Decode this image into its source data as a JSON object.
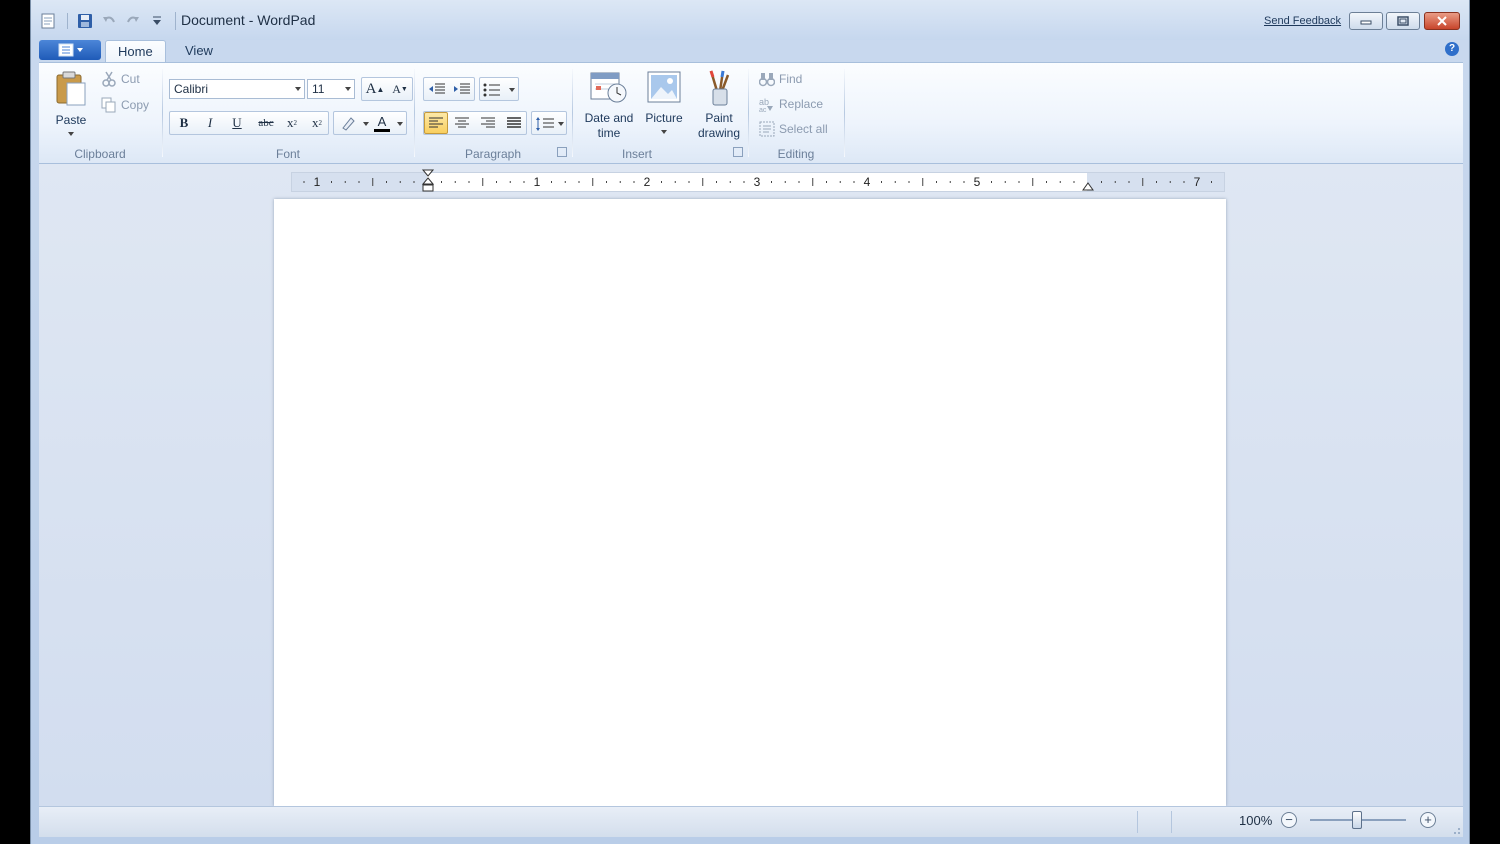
{
  "window": {
    "title": "Document - WordPad",
    "send_feedback": "Send Feedback"
  },
  "ribbon_tabs": {
    "home": "Home",
    "view": "View"
  },
  "help": "?",
  "clipboard": {
    "label": "Clipboard",
    "paste": "Paste",
    "cut": "Cut",
    "copy": "Copy"
  },
  "font": {
    "label": "Font",
    "family": "Calibri",
    "size": "11",
    "grow": "A",
    "shrink": "A",
    "bold": "B",
    "italic": "I",
    "underline": "U",
    "strikethrough": "abc",
    "subscript": "x",
    "superscript": "x",
    "color_letter": "A",
    "color_bar": "#000000"
  },
  "paragraph": {
    "label": "Paragraph"
  },
  "insert": {
    "label": "Insert",
    "datetime": [
      "Date and",
      "time"
    ],
    "picture": "Picture",
    "paint": [
      "Paint",
      "drawing"
    ]
  },
  "editing": {
    "label": "Editing",
    "find": "Find",
    "replace": "Replace",
    "select_all": "Select all"
  },
  "ruler": {
    "labels": [
      "1",
      "1",
      "2",
      "3",
      "4",
      "5",
      "7"
    ]
  },
  "status": {
    "zoom": "100%",
    "zoom_out": "−",
    "zoom_in": "+"
  },
  "colors": {
    "accent": "#1f5bb8",
    "selected": "#f9cf5f",
    "close": "#c8452b"
  }
}
